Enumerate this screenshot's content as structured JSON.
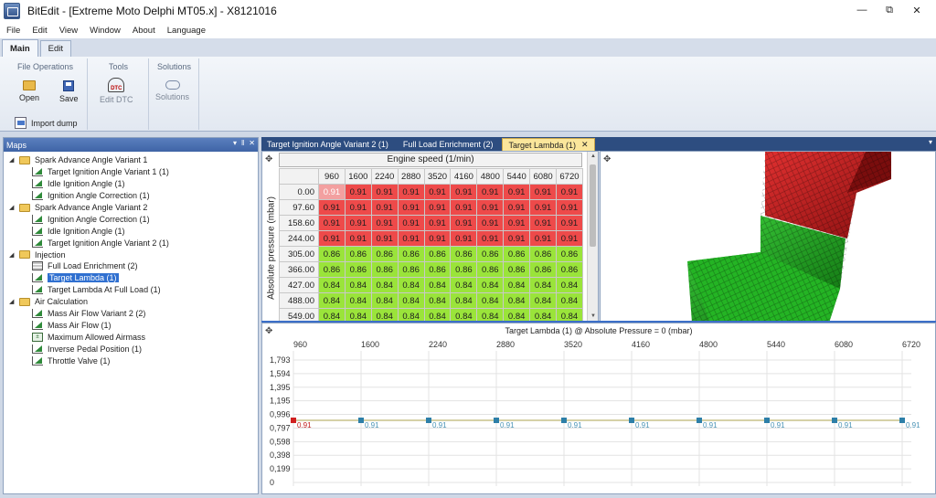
{
  "window": {
    "title": "BitEdit - [Extreme Moto Delphi MT05.x] - X8121016",
    "controls": [
      "—",
      "⧉",
      "✕"
    ]
  },
  "menu": [
    "File",
    "Edit",
    "View",
    "Window",
    "About",
    "Language"
  ],
  "ribbon": {
    "tabs": [
      "Main",
      "Edit"
    ],
    "groups": {
      "file_operations": {
        "title": "File Operations",
        "open": "Open",
        "save": "Save",
        "import": "Import dump"
      },
      "tools": {
        "title": "Tools",
        "edit_dtc": "Edit DTC",
        "dtc_icon_text": "DTC"
      },
      "solutions": {
        "title": "Solutions",
        "solutions": "Solutions"
      }
    }
  },
  "maps_panel": {
    "title": "Maps",
    "header_buttons": [
      "▾",
      "‖",
      "✕"
    ],
    "tree": [
      {
        "label": "Spark Advance Angle Variant 1",
        "level": 0,
        "type": "folder"
      },
      {
        "label": "Target Ignition Angle Variant 1 (1)",
        "level": 1,
        "type": "curve"
      },
      {
        "label": "Idle Ignition Angle (1)",
        "level": 1,
        "type": "curve"
      },
      {
        "label": "Ignition Angle Correction (1)",
        "level": 1,
        "type": "curve"
      },
      {
        "label": "Spark Advance Angle Variant 2",
        "level": 0,
        "type": "folder"
      },
      {
        "label": "Ignition Angle Correction (1)",
        "level": 1,
        "type": "curve"
      },
      {
        "label": "Idle Ignition Angle (1)",
        "level": 1,
        "type": "curve"
      },
      {
        "label": "Target Ignition Angle Variant 2 (1)",
        "level": 1,
        "type": "curve"
      },
      {
        "label": "Injection",
        "level": 0,
        "type": "folder"
      },
      {
        "label": "Full Load Enrichment (2)",
        "level": 1,
        "type": "table"
      },
      {
        "label": "Target Lambda (1)",
        "level": 1,
        "type": "curve",
        "selected": true
      },
      {
        "label": "Target Lambda At Full Load (1)",
        "level": 1,
        "type": "curve"
      },
      {
        "label": "Air Calculation",
        "level": 0,
        "type": "folder"
      },
      {
        "label": "Mass Air Flow Variant 2 (2)",
        "level": 1,
        "type": "curve"
      },
      {
        "label": "Mass Air Flow (1)",
        "level": 1,
        "type": "curve"
      },
      {
        "label": "Maximum Allowed Airmass",
        "level": 1,
        "type": "value"
      },
      {
        "label": "Inverse Pedal Position (1)",
        "level": 1,
        "type": "curve"
      },
      {
        "label": "Throttle Valve (1)",
        "level": 1,
        "type": "curve"
      }
    ]
  },
  "doc_tabs": [
    {
      "label": "Target Ignition Angle Variant 2 (1)",
      "active": false
    },
    {
      "label": "Full Load Enrichment (2)",
      "active": false
    },
    {
      "label": "Target Lambda (1)",
      "active": true
    }
  ],
  "table": {
    "x_axis_title": "Engine speed (1/min)",
    "y_axis_title": "Absolute pressure (mbar)",
    "columns": [
      "960",
      "1600",
      "2240",
      "2880",
      "3520",
      "4160",
      "4800",
      "5440",
      "6080",
      "6720"
    ],
    "rows": [
      {
        "pressure": "0.00",
        "values": [
          "0.91",
          "0.91",
          "0.91",
          "0.91",
          "0.91",
          "0.91",
          "0.91",
          "0.91",
          "0.91",
          "0.91"
        ],
        "zone": "red"
      },
      {
        "pressure": "97.60",
        "values": [
          "0.91",
          "0.91",
          "0.91",
          "0.91",
          "0.91",
          "0.91",
          "0.91",
          "0.91",
          "0.91",
          "0.91"
        ],
        "zone": "red"
      },
      {
        "pressure": "158.60",
        "values": [
          "0.91",
          "0.91",
          "0.91",
          "0.91",
          "0.91",
          "0.91",
          "0.91",
          "0.91",
          "0.91",
          "0.91"
        ],
        "zone": "red"
      },
      {
        "pressure": "244.00",
        "values": [
          "0.91",
          "0.91",
          "0.91",
          "0.91",
          "0.91",
          "0.91",
          "0.91",
          "0.91",
          "0.91",
          "0.91"
        ],
        "zone": "red"
      },
      {
        "pressure": "305.00",
        "values": [
          "0.86",
          "0.86",
          "0.86",
          "0.86",
          "0.86",
          "0.86",
          "0.86",
          "0.86",
          "0.86",
          "0.86"
        ],
        "zone": "green"
      },
      {
        "pressure": "366.00",
        "values": [
          "0.86",
          "0.86",
          "0.86",
          "0.86",
          "0.86",
          "0.86",
          "0.86",
          "0.86",
          "0.86",
          "0.86"
        ],
        "zone": "green"
      },
      {
        "pressure": "427.00",
        "values": [
          "0.84",
          "0.84",
          "0.84",
          "0.84",
          "0.84",
          "0.84",
          "0.84",
          "0.84",
          "0.84",
          "0.84"
        ],
        "zone": "green"
      },
      {
        "pressure": "488.00",
        "values": [
          "0.84",
          "0.84",
          "0.84",
          "0.84",
          "0.84",
          "0.84",
          "0.84",
          "0.84",
          "0.84",
          "0.84"
        ],
        "zone": "green"
      },
      {
        "pressure": "549.00",
        "values": [
          "0.84",
          "0.84",
          "0.84",
          "0.84",
          "0.84",
          "0.84",
          "0.84",
          "0.84",
          "0.84",
          "0.84"
        ],
        "zone": "green"
      }
    ]
  },
  "colors": {
    "rich": "#ee4a4a",
    "lean": "#9ae43a",
    "selected_tab": "#fbe69b",
    "accent": "#3070d0"
  },
  "curve": {
    "title": "Target Lambda (1) @ Absolute Pressure = 0 (mbar)",
    "x": [
      "960",
      "1600",
      "2240",
      "2880",
      "3520",
      "4160",
      "4800",
      "5440",
      "6080",
      "6720"
    ],
    "y_ticks": [
      "1,793",
      "1,594",
      "1,395",
      "1,195",
      "0,996",
      "0,797",
      "0,598",
      "0,398",
      "0,199",
      "0"
    ],
    "values": [
      "0.91",
      "0.91",
      "0.91",
      "0.91",
      "0.91",
      "0.91",
      "0.91",
      "0.91",
      "0.91",
      "0.91"
    ],
    "ylim": [
      0,
      1.793
    ]
  }
}
